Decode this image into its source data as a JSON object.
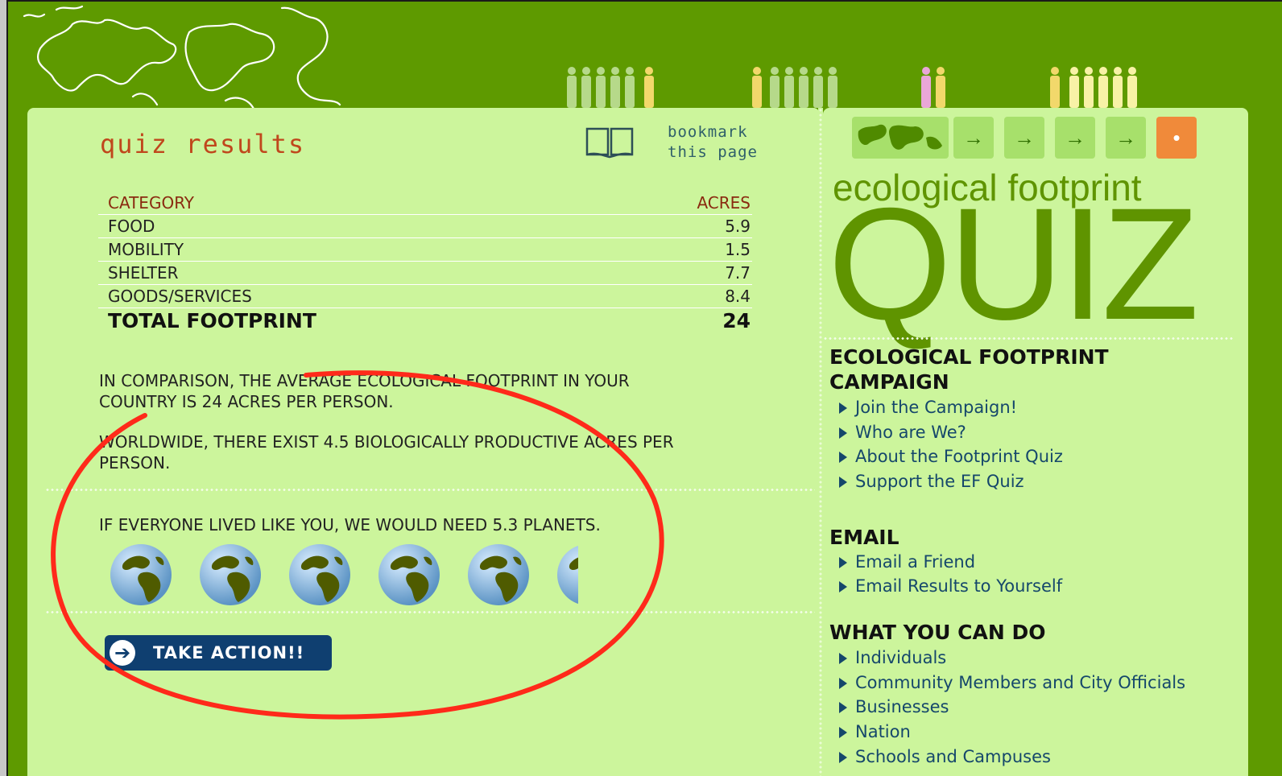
{
  "header": {
    "people_colors": [
      "#b6d98a",
      "#f2d86b",
      "#e9a7d8",
      "#f8f2a6"
    ]
  },
  "main": {
    "title": "quiz results",
    "bookmark": {
      "line1": "bookmark",
      "line2": "this page"
    },
    "table": {
      "headers": [
        "CATEGORY",
        "ACRES"
      ],
      "rows": [
        {
          "category": "FOOD",
          "acres": "5.9"
        },
        {
          "category": "MOBILITY",
          "acres": "1.5"
        },
        {
          "category": "SHELTER",
          "acres": "7.7"
        },
        {
          "category": "GOODS/SERVICES",
          "acres": "8.4"
        }
      ],
      "total": {
        "label": "TOTAL FOOTPRINT",
        "value": "24"
      }
    },
    "comparison_line1": "IN COMPARISON, THE AVERAGE ECOLOGICAL FOOTPRINT IN YOUR",
    "comparison_line2": "COUNTRY IS 24 ACRES PER PERSON.",
    "worldwide_line1": "WORLDWIDE, THERE EXIST 4.5 BIOLOGICALLY PRODUCTIVE ACRES PER",
    "worldwide_line2": "PERSON.",
    "planets_text": "IF EVERYONE LIVED LIKE YOU, WE WOULD NEED 5.3 PLANETS.",
    "planets_count": 5.3,
    "take_action": "TAKE ACTION!!"
  },
  "sidebar": {
    "nav_steps": [
      "→",
      "→",
      "→",
      "→",
      "•"
    ],
    "eco_title": "ecological footprint",
    "quiz_big": "QUIZ",
    "sections": [
      {
        "title_line1": "ECOLOGICAL FOOTPRINT",
        "title_line2": "CAMPAIGN",
        "links": [
          "Join the Campaign!",
          "Who are We?",
          "About the Footprint Quiz",
          "Support the EF Quiz"
        ]
      },
      {
        "title_line1": "EMAIL",
        "links": [
          "Email a Friend",
          "Email Results to Yourself"
        ]
      },
      {
        "title_line1": "WHAT YOU CAN DO",
        "links": [
          "Individuals",
          "Community Members and City Officials",
          "Businesses",
          "Nation",
          "Schools and Campuses"
        ]
      }
    ]
  },
  "annotation": {
    "color": "#ff2a1a"
  }
}
